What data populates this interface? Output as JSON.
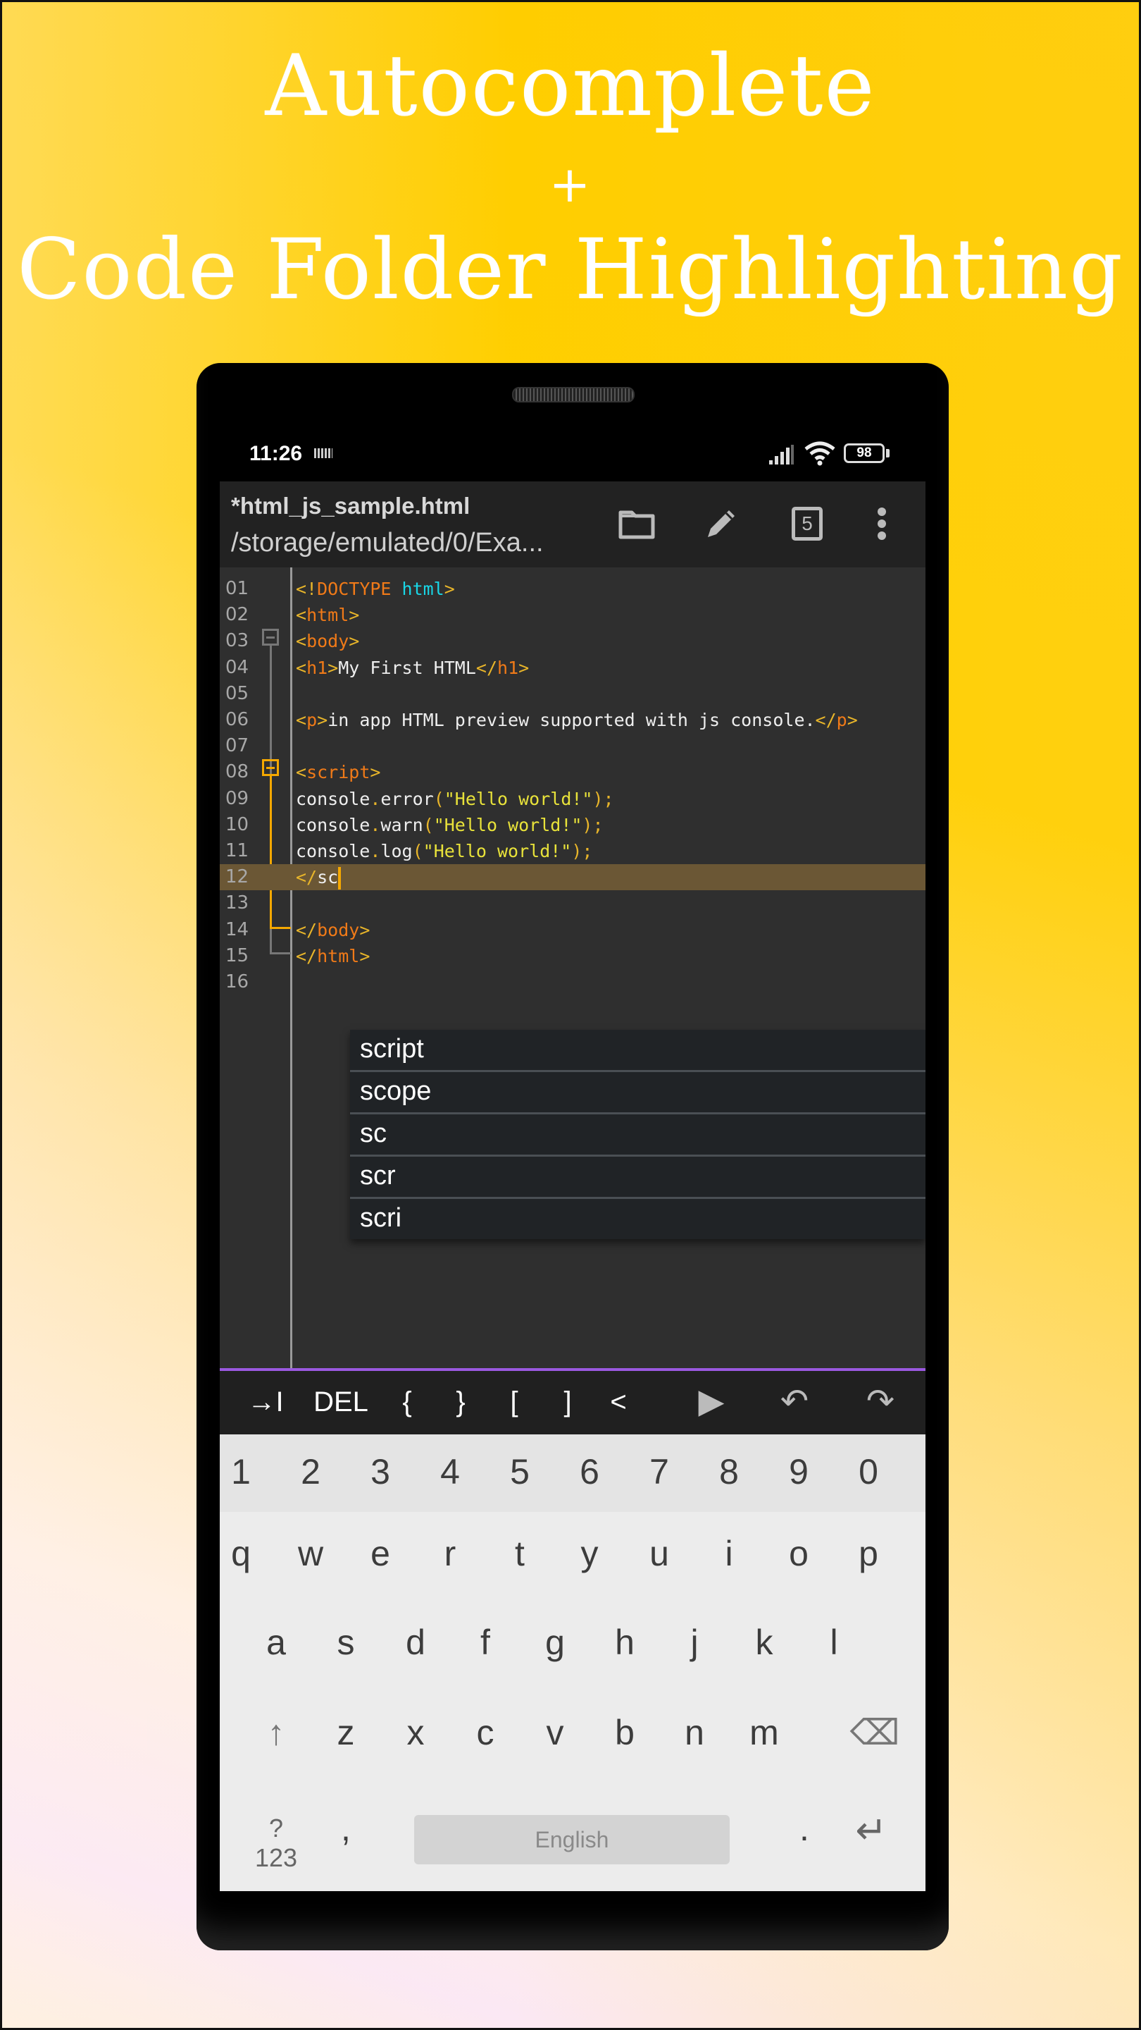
{
  "promo": {
    "title_line1": "Autocomplete",
    "title_plus": "+",
    "title_line2": "Code Folder Highlighting"
  },
  "status_bar": {
    "time": "11:26",
    "battery": "98",
    "icons": [
      "keyboard-icon",
      "signal-icon",
      "wifi-icon",
      "battery-icon"
    ]
  },
  "toolbar": {
    "filename": "*html_js_sample.html",
    "path": "/storage/emulated/0/Exa...",
    "tabs_count": "5",
    "actions": [
      "folder-icon",
      "pencil-icon",
      "tabs-icon",
      "more-vert-icon"
    ]
  },
  "editor": {
    "current_line": 12,
    "lines": [
      {
        "n": "01",
        "tokens": [
          [
            "br",
            "<!"
          ],
          [
            "tag",
            "DOCTYPE"
          ],
          [
            "txt",
            " "
          ],
          [
            "attr",
            "html"
          ],
          [
            "br",
            ">"
          ]
        ]
      },
      {
        "n": "02",
        "tokens": [
          [
            "br",
            "<"
          ],
          [
            "tag",
            "html"
          ],
          [
            "br",
            ">"
          ]
        ]
      },
      {
        "n": "03",
        "tokens": [
          [
            "br",
            "<"
          ],
          [
            "tag",
            "body"
          ],
          [
            "br",
            ">"
          ]
        ]
      },
      {
        "n": "04",
        "tokens": [
          [
            "br",
            "<"
          ],
          [
            "tag",
            "h1"
          ],
          [
            "br",
            ">"
          ],
          [
            "txt",
            "My First HTML"
          ],
          [
            "br",
            "</"
          ],
          [
            "tag",
            "h1"
          ],
          [
            "br",
            ">"
          ]
        ]
      },
      {
        "n": "05",
        "tokens": []
      },
      {
        "n": "06",
        "tokens": [
          [
            "br",
            "<"
          ],
          [
            "tag",
            "p"
          ],
          [
            "br",
            ">"
          ],
          [
            "txt",
            "in app HTML preview supported with js console."
          ],
          [
            "br",
            "</"
          ],
          [
            "tag",
            "p"
          ],
          [
            "br",
            ">"
          ]
        ]
      },
      {
        "n": "07",
        "tokens": []
      },
      {
        "n": "08",
        "tokens": [
          [
            "br",
            "<"
          ],
          [
            "tag",
            "script"
          ],
          [
            "br",
            ">"
          ]
        ]
      },
      {
        "n": "09",
        "tokens": [
          [
            "txt",
            "console"
          ],
          [
            "dot",
            "."
          ],
          [
            "txt",
            "error"
          ],
          [
            "br",
            "("
          ],
          [
            "str",
            "\"Hello world!\""
          ],
          [
            "br",
            ");"
          ]
        ]
      },
      {
        "n": "10",
        "tokens": [
          [
            "txt",
            "console"
          ],
          [
            "dot",
            "."
          ],
          [
            "txt",
            "warn"
          ],
          [
            "br",
            "("
          ],
          [
            "str",
            "\"Hello world!\""
          ],
          [
            "br",
            ");"
          ]
        ]
      },
      {
        "n": "11",
        "tokens": [
          [
            "txt",
            "console"
          ],
          [
            "dot",
            "."
          ],
          [
            "txt",
            "log"
          ],
          [
            "br",
            "("
          ],
          [
            "str",
            "\"Hello world!\""
          ],
          [
            "br",
            ");"
          ]
        ]
      },
      {
        "n": "12",
        "tokens": [
          [
            "br",
            "</"
          ],
          [
            "txt",
            "sc"
          ]
        ]
      },
      {
        "n": "13",
        "tokens": []
      },
      {
        "n": "14",
        "tokens": [
          [
            "br",
            "</"
          ],
          [
            "tag",
            "body"
          ],
          [
            "br",
            ">"
          ]
        ]
      },
      {
        "n": "15",
        "tokens": [
          [
            "br",
            "</"
          ],
          [
            "tag",
            "html"
          ],
          [
            "br",
            ">"
          ]
        ]
      },
      {
        "n": "16",
        "tokens": []
      }
    ]
  },
  "autocomplete": {
    "suggestions": [
      "script",
      "scope",
      "sc",
      "scr",
      "scri"
    ]
  },
  "key_bar": {
    "keys": [
      {
        "label": "→I",
        "name": "tab-key"
      },
      {
        "label": "DEL",
        "name": "del-key"
      },
      {
        "label": "{",
        "name": "open-brace-key"
      },
      {
        "label": "}",
        "name": "close-brace-key"
      },
      {
        "label": "[",
        "name": "open-bracket-key"
      },
      {
        "label": "]",
        "name": "close-bracket-key"
      },
      {
        "label": "<",
        "name": "less-than-key"
      },
      {
        "label": "▶",
        "name": "run-button"
      },
      {
        "label": "↶",
        "name": "undo-button"
      },
      {
        "label": "↷",
        "name": "redo-button"
      }
    ]
  },
  "keyboard": {
    "numbers": [
      "1",
      "2",
      "3",
      "4",
      "5",
      "6",
      "7",
      "8",
      "9",
      "0"
    ],
    "row1": [
      "q",
      "w",
      "e",
      "r",
      "t",
      "y",
      "u",
      "i",
      "o",
      "p"
    ],
    "row2": [
      "a",
      "s",
      "d",
      "f",
      "g",
      "h",
      "j",
      "k",
      "l"
    ],
    "row3": [
      "z",
      "x",
      "c",
      "v",
      "b",
      "n",
      "m"
    ],
    "shift": "↑",
    "backspace": "⌫",
    "symbols": "?123",
    "comma": ",",
    "space": "English",
    "period": ".",
    "enter": "↵"
  },
  "colors": {
    "accent_purple": "#9b59e0",
    "fold_active": "#f5a800",
    "current_line": "#6b5735",
    "editor_bg": "#2f2f2f"
  }
}
